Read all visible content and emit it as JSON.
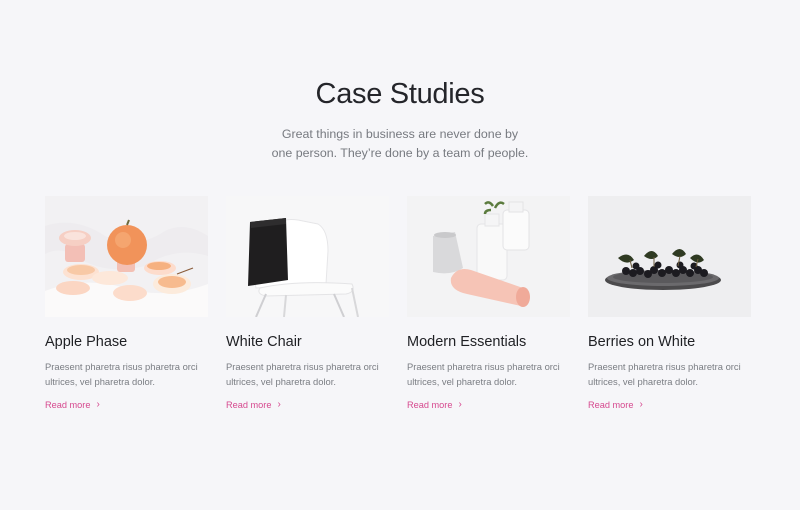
{
  "header": {
    "title": "Case Studies",
    "subtitle": "Great things in business are never done by one person. They’re done by a team of people."
  },
  "cards": [
    {
      "title": "Apple Phase",
      "text": "Praesent pharetra risus pharetra orci ultrices, vel pharetra dolor.",
      "link": "Read more",
      "link_icon": "chevron-right-icon"
    },
    {
      "title": "White Chair",
      "text": "Praesent pharetra risus pharetra orci ultrices, vel pharetra dolor.",
      "link": "Read more",
      "link_icon": "chevron-right-icon"
    },
    {
      "title": "Modern Essentials",
      "text": "Praesent pharetra risus pharetra orci ultrices, vel pharetra dolor.",
      "link": "Read more",
      "link_icon": "chevron-right-icon"
    },
    {
      "title": "Berries on White",
      "text": "Praesent pharetra risus pharetra orci ultrices, vel pharetra dolor.",
      "link": "Read more",
      "link_icon": "chevron-right-icon"
    }
  ],
  "colors": {
    "background": "#f6f6f9",
    "link": "#d6498f",
    "title": "#24252a"
  }
}
